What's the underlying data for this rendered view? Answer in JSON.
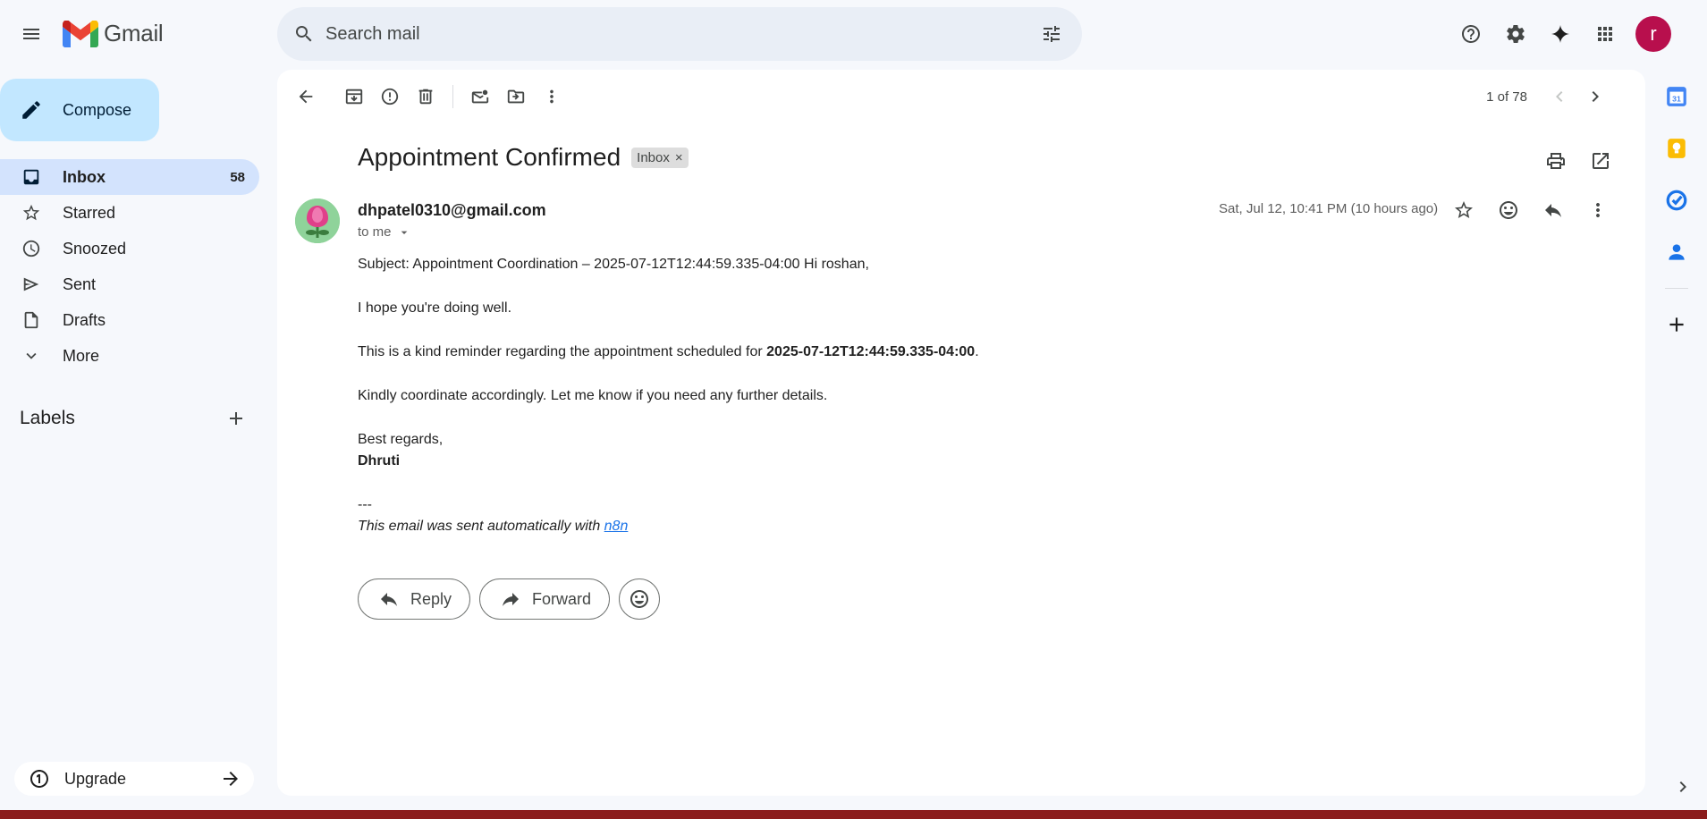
{
  "app": {
    "name": "Gmail"
  },
  "search": {
    "placeholder": "Search mail"
  },
  "account": {
    "initial": "r"
  },
  "compose": {
    "label": "Compose"
  },
  "nav": [
    {
      "label": "Inbox",
      "count": "58",
      "icon": "inbox-icon"
    },
    {
      "label": "Starred",
      "count": "",
      "icon": "star-icon"
    },
    {
      "label": "Snoozed",
      "count": "",
      "icon": "clock-icon"
    },
    {
      "label": "Sent",
      "count": "",
      "icon": "send-icon"
    },
    {
      "label": "Drafts",
      "count": "",
      "icon": "draft-icon"
    },
    {
      "label": "More",
      "count": "",
      "icon": "chevron-down-icon"
    }
  ],
  "labels": {
    "title": "Labels"
  },
  "upgrade": {
    "label": "Upgrade"
  },
  "pager": {
    "text": "1 of 78"
  },
  "email": {
    "subject": "Appointment Confirmed",
    "chip": "Inbox",
    "chip_close": "×",
    "sender": "dhpatel0310@gmail.com",
    "to": "to me",
    "date": "Sat, Jul 12, 10:41 PM (10 hours ago)",
    "line1": "Subject: Appointment Coordination – 2025-07-12T12:44:59.335-04:00 Hi roshan,",
    "line2": "I hope you're doing well.",
    "line3_pre": "This is a kind reminder regarding the appointment scheduled for ",
    "line3_bold": "2025-07-12T12:44:59.335-04:00",
    "line3_post": ".",
    "line4": "Kindly coordinate accordingly. Let me know if you need any further details.",
    "regards": "Best regards,",
    "signature": "Dhruti",
    "separator": "---",
    "footer_pre": "This email was sent automatically with ",
    "footer_link": "n8n"
  },
  "actions": {
    "reply": "Reply",
    "forward": "Forward"
  },
  "colors": {
    "accent": "#c2e7ff",
    "nav_active": "#d3e3fd",
    "avatar": "#b80f4d",
    "link": "#1a73e8"
  }
}
